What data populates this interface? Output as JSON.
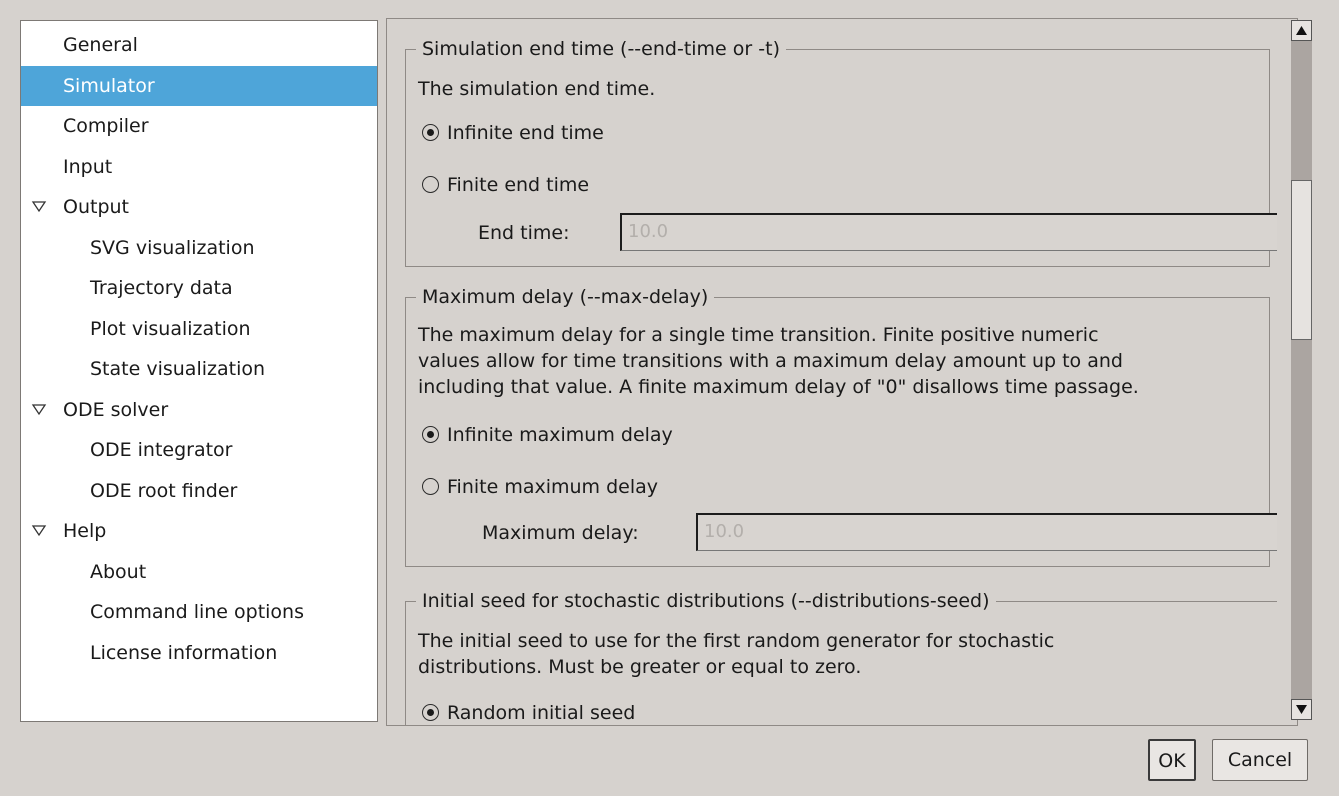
{
  "tree": {
    "items": [
      {
        "label": "General",
        "level": 0,
        "selected": false
      },
      {
        "label": "Simulator",
        "level": 0,
        "selected": true
      },
      {
        "label": "Compiler",
        "level": 0,
        "selected": false
      },
      {
        "label": "Input",
        "level": 0,
        "selected": false
      },
      {
        "label": "Output",
        "level": 0,
        "selected": false,
        "expanded": true
      },
      {
        "label": "SVG visualization",
        "level": 1,
        "selected": false
      },
      {
        "label": "Trajectory data",
        "level": 1,
        "selected": false
      },
      {
        "label": "Plot visualization",
        "level": 1,
        "selected": false
      },
      {
        "label": "State visualization",
        "level": 1,
        "selected": false
      },
      {
        "label": "ODE solver",
        "level": 0,
        "selected": false,
        "expanded": true
      },
      {
        "label": "ODE integrator",
        "level": 1,
        "selected": false
      },
      {
        "label": "ODE root finder",
        "level": 1,
        "selected": false
      },
      {
        "label": "Help",
        "level": 0,
        "selected": false,
        "expanded": true
      },
      {
        "label": "About",
        "level": 1,
        "selected": false
      },
      {
        "label": "Command line options",
        "level": 1,
        "selected": false
      },
      {
        "label": "License information",
        "level": 1,
        "selected": false
      }
    ],
    "expander_icon": "triangle-down-icon",
    "selected_color": "#4ea5d9"
  },
  "sections": {
    "end_time": {
      "title": "Simulation end time (--end-time or -t)",
      "description": "The simulation end time.",
      "option_infinite": "Infinite end time",
      "option_finite": "Finite end time",
      "selected": "infinite",
      "field_label": "End time:",
      "field_value": "10.0"
    },
    "max_delay": {
      "title": "Maximum delay (--max-delay)",
      "description_lines": [
        "The maximum delay for a single time transition. Finite positive numeric",
        "values allow for time transitions with a maximum delay amount up to and",
        "including that value. A finite maximum delay of \"0\" disallows time passage."
      ],
      "option_infinite": "Infinite maximum delay",
      "option_finite": "Finite maximum delay",
      "selected": "infinite",
      "field_label": "Maximum delay:",
      "field_value": "10.0"
    },
    "seed": {
      "title": "Initial seed for stochastic distributions (--distributions-seed)",
      "description_lines": [
        "The initial seed to use for the first random generator for stochastic",
        "distributions. Must be greater or equal to zero."
      ],
      "option_random": "Random initial seed",
      "selected": "random"
    }
  },
  "scrollbar": {
    "up_icon": "arrow-up-icon",
    "down_icon": "arrow-down-icon"
  },
  "buttons": {
    "ok": "OK",
    "cancel": "Cancel"
  }
}
